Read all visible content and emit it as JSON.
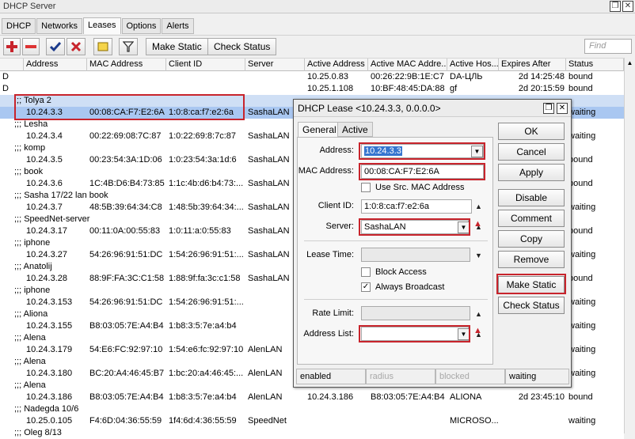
{
  "window": {
    "title": "DHCP Server",
    "restore_btn": "❐",
    "close_btn": "✕"
  },
  "tabs": [
    "DHCP",
    "Networks",
    "Leases",
    "Options",
    "Alerts"
  ],
  "toolbar": {
    "make_static": "Make Static",
    "check_status": "Check Status",
    "find_placeholder": "Find"
  },
  "columns": [
    "Address",
    "MAC Address",
    "Client ID",
    "Server",
    "Active Address",
    "Active MAC Addre...",
    "Active Hos...",
    "Expires After",
    "Status"
  ],
  "rows": [
    {
      "kind": "data",
      "flag": "D",
      "addr": "",
      "mac": "",
      "cid": "",
      "srv": "",
      "aaddr": "10.25.0.83",
      "amac": "00:26:22:9B:1E:C7",
      "ahost": "DA-ЦЛЬ",
      "exp": "2d 14:25:48",
      "status": "bound"
    },
    {
      "kind": "data",
      "flag": "D",
      "addr": "",
      "mac": "",
      "cid": "",
      "srv": "",
      "aaddr": "10.25.1.108",
      "amac": "10:BF:48:45:DA:88",
      "ahost": "gf",
      "exp": "2d 20:15:59",
      "status": "bound"
    },
    {
      "kind": "comment",
      "text": ";;; Tolya 2"
    },
    {
      "kind": "data",
      "flag": "",
      "addr": "10.24.3.3",
      "mac": "00:08:CA:F7:E2:6A",
      "cid": "1:0:8:ca:f7:e2:6a",
      "srv": "SashaLAN",
      "aaddr": "",
      "amac": "",
      "ahost": "",
      "exp": "",
      "status": "waiting"
    },
    {
      "kind": "comment",
      "text": ";;; Lesha"
    },
    {
      "kind": "data",
      "flag": "",
      "addr": "10.24.3.4",
      "mac": "00:22:69:08:7C:87",
      "cid": "1:0:22:69:8:7c:87",
      "srv": "SashaLAN",
      "aaddr": "",
      "amac": "",
      "ahost": "",
      "exp": "",
      "status": "waiting"
    },
    {
      "kind": "comment",
      "text": ";;; komp"
    },
    {
      "kind": "data",
      "flag": "",
      "addr": "10.24.3.5",
      "mac": "00:23:54:3A:1D:06",
      "cid": "1:0:23:54:3a:1d:6",
      "srv": "SashaLAN",
      "aaddr": "",
      "amac": "",
      "ahost": "",
      "exp": "",
      "status": "bound"
    },
    {
      "kind": "comment",
      "text": ";;; book"
    },
    {
      "kind": "data",
      "flag": "",
      "addr": "10.24.3.6",
      "mac": "1C:4B:D6:B4:73:85",
      "cid": "1:1c:4b:d6:b4:73:...",
      "srv": "SashaLAN",
      "aaddr": "",
      "amac": "",
      "ahost": "",
      "exp": "",
      "status": "bound"
    },
    {
      "kind": "comment",
      "text": ";;; Sasha 17/22 lan book"
    },
    {
      "kind": "data",
      "flag": "",
      "addr": "10.24.3.7",
      "mac": "48:5B:39:64:34:C8",
      "cid": "1:48:5b:39:64:34:...",
      "srv": "SashaLAN",
      "aaddr": "",
      "amac": "",
      "ahost": "",
      "exp": "",
      "status": "waiting"
    },
    {
      "kind": "comment",
      "text": ";;; SpeedNet-server"
    },
    {
      "kind": "data",
      "flag": "",
      "addr": "10.24.3.17",
      "mac": "00:11:0A:00:55:83",
      "cid": "1:0:11:a:0:55:83",
      "srv": "SashaLAN",
      "aaddr": "",
      "amac": "",
      "ahost": "",
      "exp": "",
      "status": "bound"
    },
    {
      "kind": "comment",
      "text": ";;; iphone"
    },
    {
      "kind": "data",
      "flag": "",
      "addr": "10.24.3.27",
      "mac": "54:26:96:91:51:DC",
      "cid": "1:54:26:96:91:51:...",
      "srv": "SashaLAN",
      "aaddr": "",
      "amac": "",
      "ahost": "",
      "exp": "",
      "status": "waiting"
    },
    {
      "kind": "comment",
      "text": ";;; Anatolij"
    },
    {
      "kind": "data",
      "flag": "",
      "addr": "10.24.3.28",
      "mac": "88:9F:FA:3C:C1:58",
      "cid": "1:88:9f:fa:3c:c1:58",
      "srv": "SashaLAN",
      "aaddr": "",
      "amac": "",
      "ahost": "",
      "exp": "",
      "status": "bound"
    },
    {
      "kind": "comment",
      "text": ";;; iphone"
    },
    {
      "kind": "data",
      "flag": "",
      "addr": "10.24.3.153",
      "mac": "54:26:96:91:51:DC",
      "cid": "1:54:26:96:91:51:...",
      "srv": "",
      "aaddr": "",
      "amac": "",
      "ahost": "",
      "exp": "",
      "status": "waiting"
    },
    {
      "kind": "comment",
      "text": ";;; Aliona"
    },
    {
      "kind": "data",
      "flag": "",
      "addr": "10.24.3.155",
      "mac": "B8:03:05:7E:A4:B4",
      "cid": "1:b8:3:5:7e:a4:b4",
      "srv": "",
      "aaddr": "",
      "amac": "",
      "ahost": "",
      "exp": "",
      "status": "waiting"
    },
    {
      "kind": "comment",
      "text": ";;; Alena"
    },
    {
      "kind": "data",
      "flag": "",
      "addr": "10.24.3.179",
      "mac": "54:E6:FC:92:97:10",
      "cid": "1:54:e6:fc:92:97:10",
      "srv": "AlenLAN",
      "aaddr": "",
      "amac": "",
      "ahost": "",
      "exp": "",
      "status": "waiting"
    },
    {
      "kind": "comment",
      "text": ";;; Alena"
    },
    {
      "kind": "data",
      "flag": "",
      "addr": "10.24.3.180",
      "mac": "BC:20:A4:46:45:B7",
      "cid": "1:bc:20:a4:46:45:...",
      "srv": "AlenLAN",
      "aaddr": "",
      "amac": "",
      "ahost": "",
      "exp": "",
      "status": "waiting"
    },
    {
      "kind": "comment",
      "text": ";;; Alena"
    },
    {
      "kind": "data",
      "flag": "",
      "addr": "10.24.3.186",
      "mac": "B8:03:05:7E:A4:B4",
      "cid": "1:b8:3:5:7e:a4:b4",
      "srv": "AlenLAN",
      "aaddr": "10.24.3.186",
      "amac": "B8:03:05:7E:A4:B4",
      "ahost": "ALIONA",
      "exp": "2d 23:45:10",
      "status": "bound"
    },
    {
      "kind": "comment",
      "text": ";;; Nadegda 10/6"
    },
    {
      "kind": "data",
      "flag": "",
      "addr": "10.25.0.105",
      "mac": "F4:6D:04:36:55:59",
      "cid": "1f4:6d:4:36:55:59",
      "srv": "SpeedNet",
      "aaddr": "",
      "amac": "",
      "ahost": "MICROSO...",
      "exp": "",
      "status": "waiting"
    },
    {
      "kind": "comment",
      "text": ";;; Oleg 8/13"
    }
  ],
  "dialog": {
    "title": "DHCP Lease <10.24.3.3, 0.0.0.0>",
    "tab_general": "General",
    "tab_active": "Active",
    "address_label": "Address:",
    "address_value": "10.24.3.3",
    "mac_label": "MAC Address:",
    "mac_value": "00:08:CA:F7:E2:6A",
    "use_src_mac": "Use Src. MAC Address",
    "client_id_label": "Client ID:",
    "client_id_value": "1:0:8:ca:f7:e2:6a",
    "server_label": "Server:",
    "server_value": "SashaLAN",
    "lease_time_label": "Lease Time:",
    "block_access": "Block Access",
    "always_broadcast": "Always Broadcast",
    "rate_limit_label": "Rate Limit:",
    "address_list_label": "Address List:",
    "buttons": [
      "OK",
      "Cancel",
      "Apply",
      "Disable",
      "Comment",
      "Copy",
      "Remove",
      "Make Static",
      "Check Status"
    ],
    "status": {
      "enabled": "enabled",
      "radius": "radius",
      "blocked": "blocked",
      "waiting": "waiting"
    }
  },
  "colors": {
    "highlight": "#c8242c",
    "selected_row": "#a9c7f1",
    "selection": "#3575cf"
  }
}
